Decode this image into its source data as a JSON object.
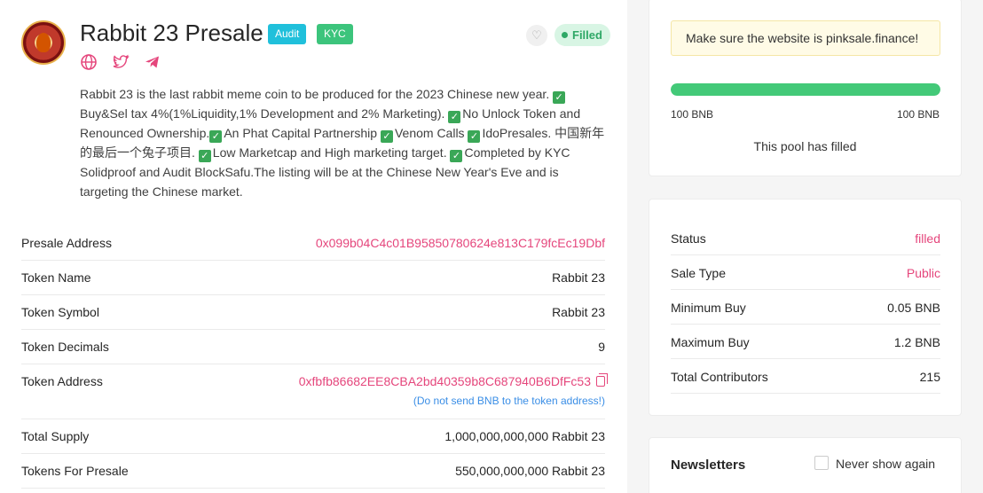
{
  "header": {
    "title": "Rabbit 23 Presale",
    "badges": [
      "Audit",
      "KYC"
    ],
    "status_pill": "Filled",
    "social_icons": [
      "globe-icon",
      "twitter-icon",
      "telegram-icon"
    ],
    "accent_color": "#e5467c"
  },
  "description": {
    "segments": [
      "Rabbit 23 is the last rabbit meme coin to be produced for the 2023 Chinese new year. ",
      "Buy&Sel tax 4%(1%Liquidity,1% Development and 2% Marketing). ",
      "No Unlock Token and Renounced Ownership.",
      "An Phat Capital Partnership ",
      "Venom Calls ",
      "IdoPresales. 中国新年的最后一个兔子项目. ",
      "Low Marketcap and High marketing target. ",
      "Completed by KYC Solidproof and Audit BlockSafu.The listing will be at the Chinese New Year's Eve and is targeting the Chinese market."
    ],
    "checkmark": "✓"
  },
  "token_info": {
    "rows": [
      {
        "label": "Presale Address",
        "value": "0x099b04C4c01B95850780624e813C179fcEc19Dbf"
      },
      {
        "label": "Token Name",
        "value": "Rabbit 23"
      },
      {
        "label": "Token Symbol",
        "value": "Rabbit 23"
      },
      {
        "label": "Token Decimals",
        "value": "9"
      },
      {
        "label": "Token Address",
        "value": "0xfbfb86682EE8CBA2bd40359b8C687940B6DfFc53",
        "note": "(Do not send BNB to the token address!)"
      },
      {
        "label": "Total Supply",
        "value": "1,000,000,000,000 Rabbit 23"
      },
      {
        "label": "Tokens For Presale",
        "value": "550,000,000,000 Rabbit 23"
      }
    ]
  },
  "sale_card": {
    "notice": "Make sure the website is pinksale.finance!",
    "progress_fraction": 1.0,
    "progress_left": "100 BNB",
    "progress_right": "100 BNB",
    "pool_status": "This pool has filled"
  },
  "status_card": {
    "rows": [
      {
        "label": "Status",
        "value": "filled"
      },
      {
        "label": "Sale Type",
        "value": "Public"
      },
      {
        "label": "Minimum Buy",
        "value": "0.05 BNB"
      },
      {
        "label": "Maximum Buy",
        "value": "1.2 BNB"
      },
      {
        "label": "Total Contributors",
        "value": "215"
      }
    ]
  },
  "newsletter": {
    "title": "Newsletters",
    "checkbox_label": "Never show again"
  }
}
